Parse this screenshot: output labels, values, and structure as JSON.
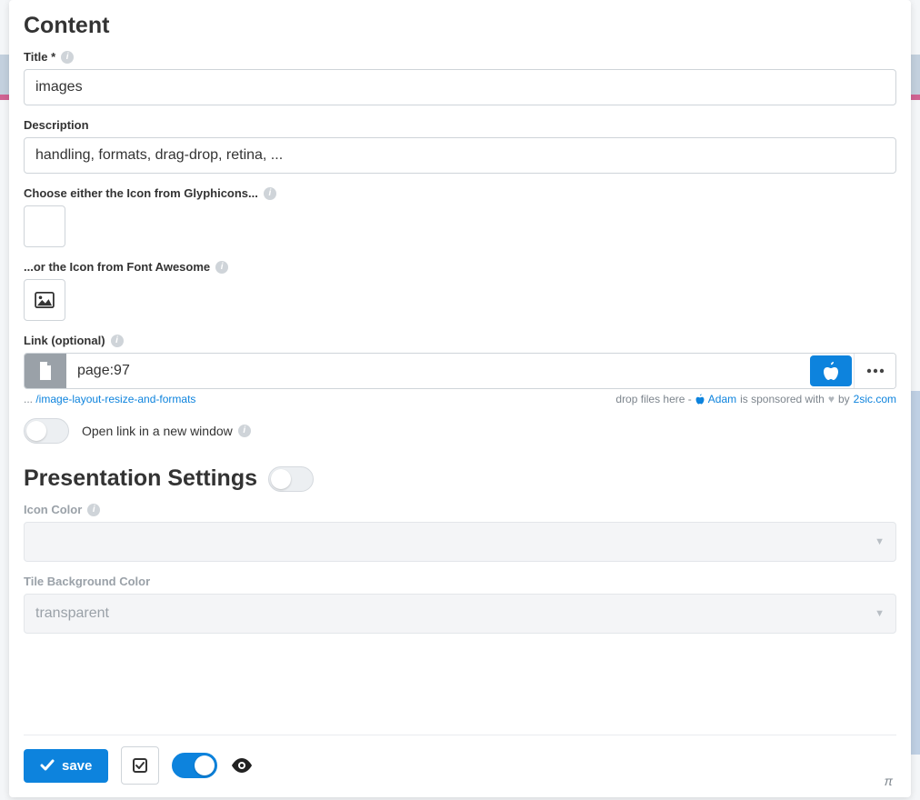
{
  "sections": {
    "content_heading": "Content",
    "presentation_heading": "Presentation Settings"
  },
  "fields": {
    "title": {
      "label": "Title *",
      "value": "images"
    },
    "description": {
      "label": "Description",
      "value": "handling, formats, drag-drop, retina, ..."
    },
    "glyphicons": {
      "label": "Choose either the Icon from Glyphicons..."
    },
    "fontawesome": {
      "label": "...or the Icon from Font Awesome"
    },
    "link": {
      "label": "Link (optional)",
      "value": "page:97",
      "resolved_prefix": "... ",
      "resolved_path": "/image-layout-resize-and-formats"
    },
    "open_new_window": {
      "label": "Open link in a new window"
    },
    "icon_color": {
      "label": "Icon Color",
      "value": ""
    },
    "tile_bg": {
      "label": "Tile Background Color",
      "value": "transparent"
    }
  },
  "sponsor": {
    "drop_hint": "drop files here -",
    "adam": "Adam",
    "mid": " is sponsored with ",
    "by": " by ",
    "site": "2sic.com"
  },
  "footer": {
    "save": "save",
    "pi": "π"
  }
}
